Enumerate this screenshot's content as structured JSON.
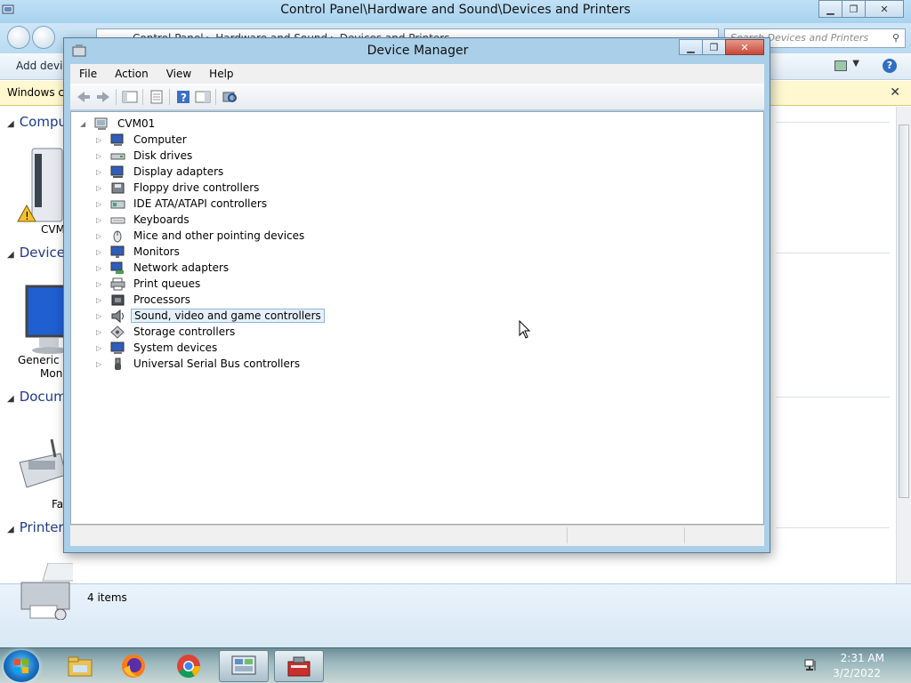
{
  "background_window": {
    "title": "Control Panel\\Hardware and Sound\\Devices and Printers",
    "address_crumbs": "Control Panel  ▸  Hardware and Sound  ▸  Devices and Printers",
    "search_placeholder": "Search Devices and Printers",
    "add_device": "Add devic",
    "info_bar": "Windows ca",
    "sections": [
      "Comput",
      "Devices",
      "Docum",
      "Printers"
    ],
    "devices": [
      "CVM",
      "Generic N",
      "Mon",
      "Fa"
    ],
    "items_count": "4 items"
  },
  "device_manager": {
    "title": "Device Manager",
    "menu": [
      "File",
      "Action",
      "View",
      "Help"
    ],
    "root": "CVM01",
    "nodes": [
      {
        "label": "Computer",
        "icon": "computer-icon"
      },
      {
        "label": "Disk drives",
        "icon": "disk-drive-icon"
      },
      {
        "label": "Display adapters",
        "icon": "display-adapter-icon"
      },
      {
        "label": "Floppy drive controllers",
        "icon": "floppy-controller-icon"
      },
      {
        "label": "IDE ATA/ATAPI controllers",
        "icon": "ide-controller-icon"
      },
      {
        "label": "Keyboards",
        "icon": "keyboard-icon"
      },
      {
        "label": "Mice and other pointing devices",
        "icon": "mouse-icon"
      },
      {
        "label": "Monitors",
        "icon": "monitor-icon"
      },
      {
        "label": "Network adapters",
        "icon": "network-adapter-icon"
      },
      {
        "label": "Print queues",
        "icon": "printer-icon"
      },
      {
        "label": "Processors",
        "icon": "processor-icon"
      },
      {
        "label": "Sound, video and game controllers",
        "icon": "speaker-icon",
        "selected": true
      },
      {
        "label": "Storage controllers",
        "icon": "storage-controller-icon"
      },
      {
        "label": "System devices",
        "icon": "system-device-icon"
      },
      {
        "label": "Universal Serial Bus controllers",
        "icon": "usb-icon"
      }
    ]
  },
  "taskbar": {
    "apps": [
      "file-explorer-icon",
      "firefox-icon",
      "chrome-icon",
      "control-panel-icon",
      "device-manager-icon"
    ],
    "time": "2:31 AM",
    "date": "3/2/2022"
  }
}
